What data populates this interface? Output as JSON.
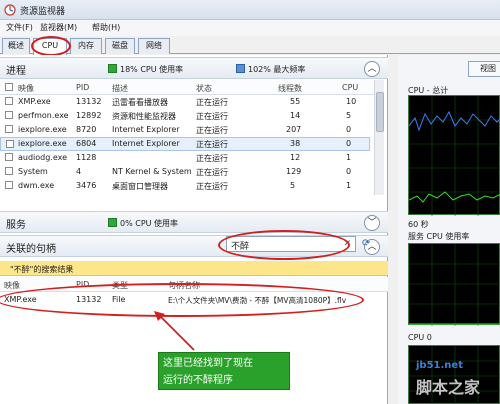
{
  "window": {
    "title": "资源监视器"
  },
  "menu": [
    "文件(F)",
    "监视器(M)",
    "帮助(H)"
  ],
  "tabs": [
    "概述",
    "CPU",
    "内存",
    "磁盘",
    "网络"
  ],
  "processes": {
    "section_title": "进程",
    "cpu_usage": "18% CPU 使用率",
    "max_freq": "102% 最大频率",
    "columns": [
      "映像",
      "PID",
      "描述",
      "状态",
      "线程数",
      "CPU"
    ],
    "rows": [
      [
        "XMP.exe",
        "13132",
        "迅雷看看播放器",
        "正在运行",
        "55",
        "10"
      ],
      [
        "perfmon.exe",
        "12892",
        "资源和性能监视器",
        "正在运行",
        "14",
        "5"
      ],
      [
        "iexplore.exe",
        "8720",
        "Internet Explorer",
        "正在运行",
        "207",
        "0"
      ],
      [
        "iexplore.exe",
        "6804",
        "Internet Explorer",
        "正在运行",
        "38",
        "0"
      ],
      [
        "audiodg.exe",
        "1128",
        "",
        "正在运行",
        "12",
        "1"
      ],
      [
        "System",
        "4",
        "NT Kernel & System",
        "正在运行",
        "129",
        "0"
      ],
      [
        "dwm.exe",
        "3476",
        "桌面窗口管理器",
        "正在运行",
        "5",
        "1"
      ]
    ]
  },
  "services": {
    "section_title": "服务",
    "cpu_usage": "0% CPU 使用率"
  },
  "handles": {
    "section_title": "关联的句柄",
    "search_value": "不醉",
    "result_banner": "\"不醉\"的搜索结果",
    "columns": [
      "映像",
      "PID",
      "类型",
      "句柄名称"
    ],
    "rows": [
      [
        "XMP.exe",
        "13132",
        "File",
        "E:\\个人文件夹\\MV\\费渤 - 不醉【MV高清1080P】.flv"
      ]
    ]
  },
  "callout": {
    "line1": "这里已经找到了现在",
    "line2": "运行的不醉程序"
  },
  "right": {
    "view_button": "视图",
    "graph1_label": "CPU - 总计",
    "graph1_time": "60 秒",
    "graph2_label": "服务 CPU 使用率",
    "graph3_label": "CPU 0"
  },
  "watermark": {
    "site": "jb51.net",
    "name": "脚本之家"
  },
  "colors": {
    "annotation": "#d31f1f",
    "callout": "#2aa12a",
    "banner": "#fde68a"
  }
}
